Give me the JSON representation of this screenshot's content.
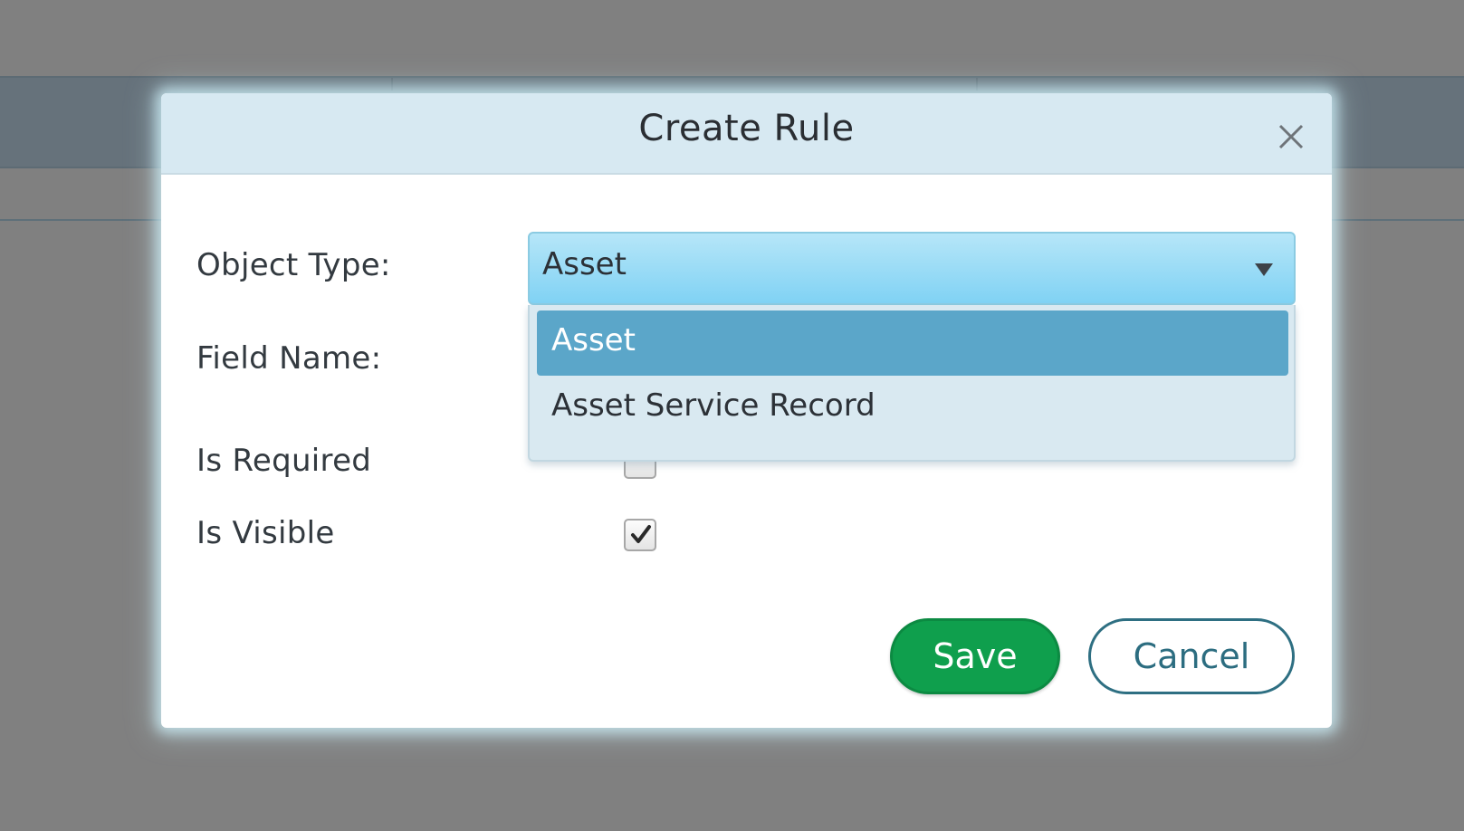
{
  "modal": {
    "title": "Create Rule",
    "close_icon": "close-icon"
  },
  "form": {
    "object_type_label": "Object Type:",
    "field_name_label": "Field Name:",
    "is_required_label": "Is Required",
    "is_visible_label": "Is Visible",
    "object_type_value": "Asset",
    "object_type_options": [
      "Asset",
      "Asset Service Record"
    ],
    "is_required_checked": false,
    "is_visible_checked": true
  },
  "buttons": {
    "save_label": "Save",
    "cancel_label": "Cancel"
  },
  "colors": {
    "save": "#0f9f4d",
    "cancel_border": "#2e6f82",
    "selected_option": "#5ba6c9",
    "header": "#d7e9f2"
  }
}
